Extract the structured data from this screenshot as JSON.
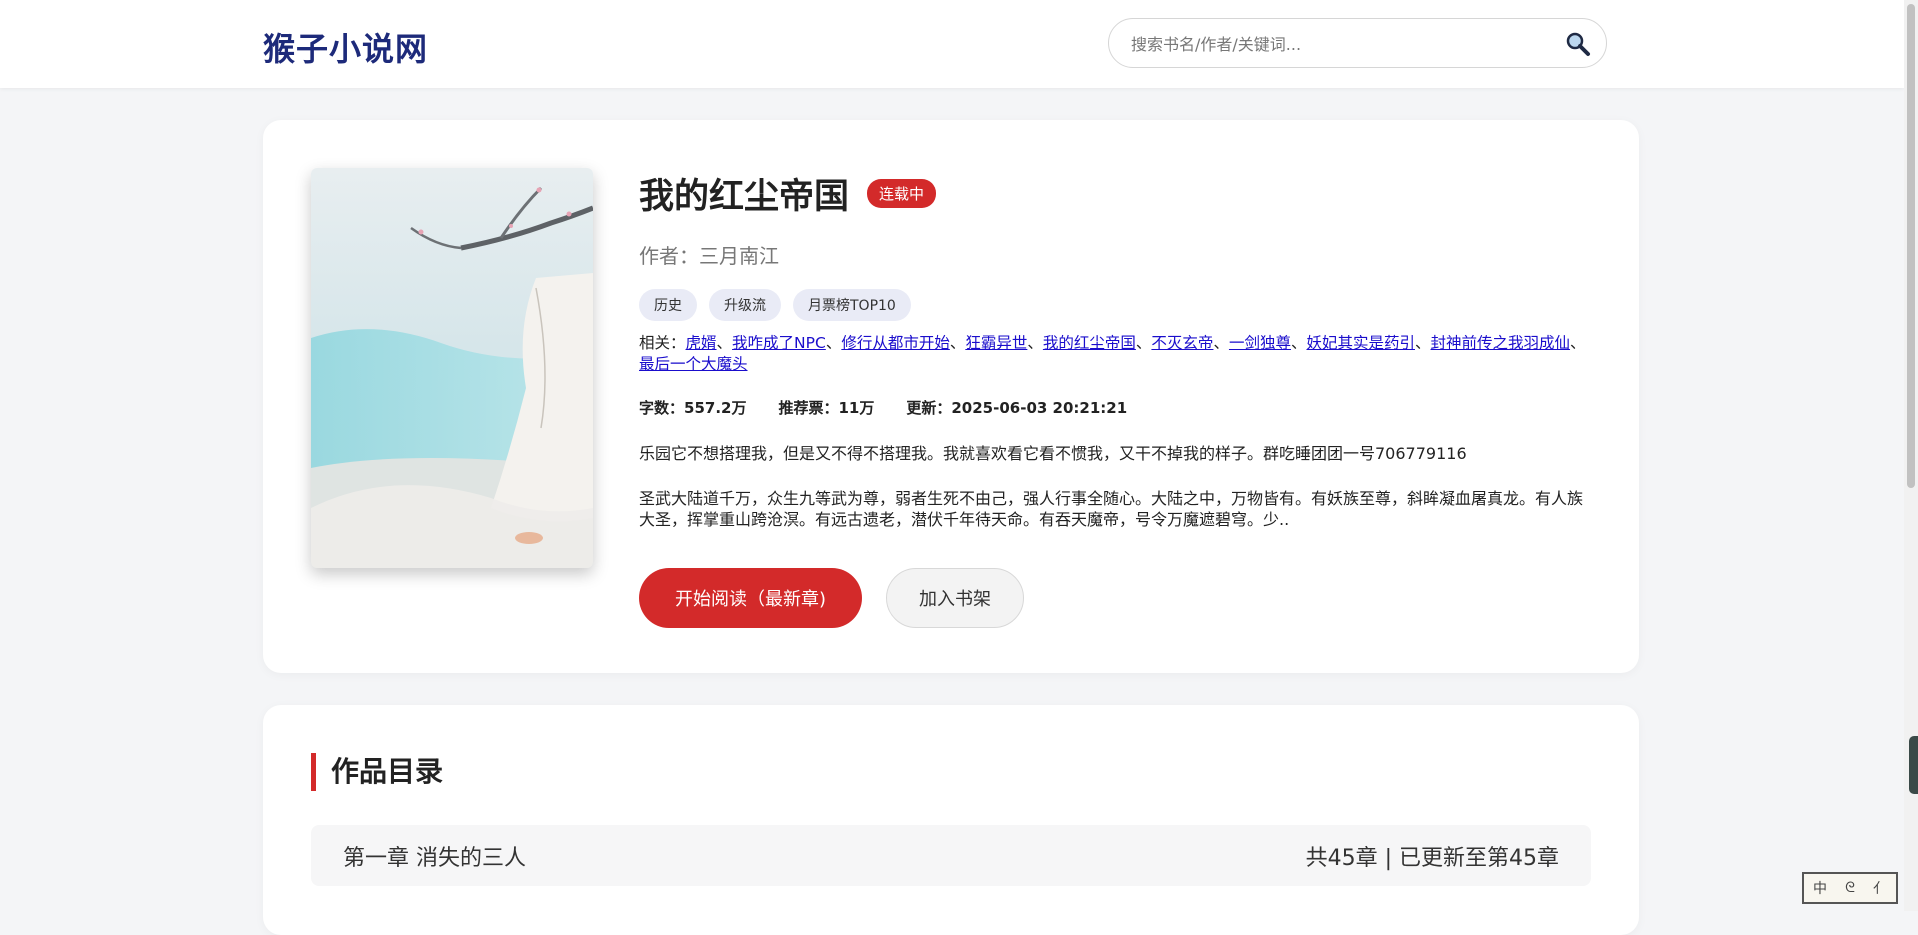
{
  "site": {
    "logo": "猴子小说网"
  },
  "search": {
    "placeholder": "搜索书名/作者/关键词..."
  },
  "book": {
    "title": "我的红尘帝国",
    "status": "连载中",
    "author": "作者：三月南江",
    "tags": [
      "历史",
      "升级流",
      "月票榜TOP10"
    ],
    "related_label": "相关：",
    "related": [
      "虎婿",
      "我咋成了NPC",
      "修行从都市开始",
      "狂霸异世",
      "我的红尘帝国",
      "不灭玄帝",
      "一剑独尊",
      "妖妃其实是药引",
      "封神前传之我羽成仙",
      "最后一个大魔头"
    ],
    "stats": {
      "words_label": "字数：",
      "words": "557.2万",
      "votes_label": "推荐票：",
      "votes": "11万",
      "updated_label": "更新：",
      "updated": "2025-06-03 20:21:21"
    },
    "intro": [
      "乐园它不想搭理我，但是又不得不搭理我。我就喜欢看它看不惯我，又干不掉我的样子。群吃睡团团一号706779116",
      "圣武大陆道千万，众生九等武为尊，弱者生死不由己，强人行事全随心。大陆之中，万物皆有。有妖族至尊，斜眸凝血屠真龙。有人族大圣，挥掌重山跨沧溟。有远古遗老，潜伏千年待天命。有吞天魔帝，号令万魔遮碧穹。少.."
    ],
    "read_button": "开始阅读（最新章)",
    "shelf_button": "加入书架"
  },
  "toc": {
    "title": "作品目录",
    "first_chapter": "第一章 消失的三人",
    "summary": "共45章 | 已更新至第45章"
  },
  "ime": {
    "chars": [
      "中",
      "ᘓ",
      "⺅"
    ]
  },
  "colors": {
    "accent": "#d32a2a",
    "logo": "#1d2a7a",
    "link": "#1a0dcc"
  }
}
